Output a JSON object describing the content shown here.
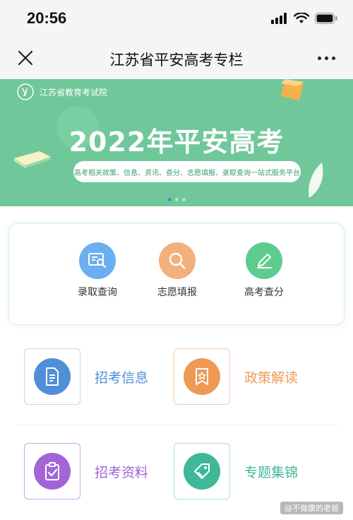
{
  "status_bar": {
    "time": "20:56"
  },
  "nav": {
    "title": "江苏省平安高考专栏"
  },
  "banner": {
    "org": "江苏省教育考试院",
    "title": "2022年平安高考",
    "subtitle": "高考相关政策、信息、资讯、查分、志愿填报、录取查询一站式服务平台"
  },
  "quick_actions": [
    {
      "label": "录取查询",
      "icon": "search-document-icon",
      "color": "#6aaff0"
    },
    {
      "label": "志愿填报",
      "icon": "magnifier-icon",
      "color": "#f3b07f"
    },
    {
      "label": "高考查分",
      "icon": "pencil-icon",
      "color": "#5ccd8e"
    }
  ],
  "grid": [
    {
      "label": "招考信息",
      "icon": "document-icon",
      "color": "#4f8fd9",
      "border": "#bcd8f3"
    },
    {
      "label": "政策解读",
      "icon": "bookmark-star-icon",
      "color": "#ee9a55",
      "border": "#f3c9a8"
    },
    {
      "label": "招考资料",
      "icon": "clipboard-check-icon",
      "color": "#a365d6",
      "border": "#cda8e8"
    },
    {
      "label": "专题集锦",
      "icon": "tag-icon",
      "color": "#3fb89a",
      "border": "#a9e0d2"
    }
  ],
  "watermark": "@不做康的老爸"
}
